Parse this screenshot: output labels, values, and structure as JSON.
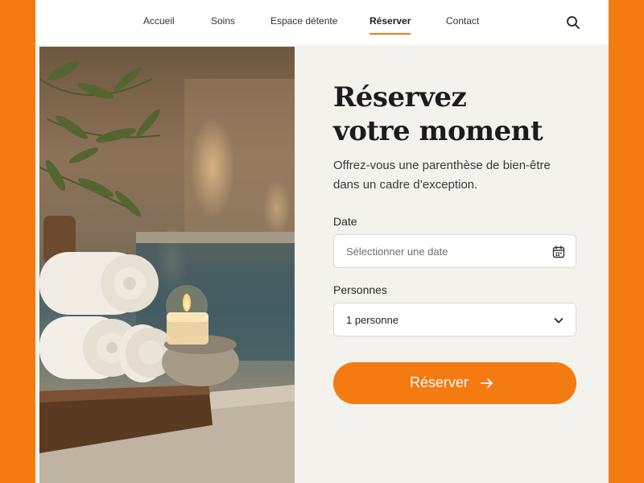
{
  "nav": {
    "items": [
      {
        "label": "Accueil"
      },
      {
        "label": "Soins"
      },
      {
        "label": "Espace détente"
      },
      {
        "label": "Réserver",
        "active": true
      },
      {
        "label": "Contact"
      }
    ],
    "search_icon": "search-icon"
  },
  "hero": {
    "image": "spa scene with rolled towels, lit candle, olive branch and pool"
  },
  "booking": {
    "title_line1": "Réservez",
    "title_line2": "votre moment",
    "subtitle_line1": "Offrez-vous une parenthèse de bien-être",
    "subtitle_line2": "dans un cadre d’exception.",
    "date": {
      "label": "Date",
      "placeholder": "Sélectionner une date",
      "icon": "calendar-icon"
    },
    "persons": {
      "label": "Personnes",
      "value": "1 personne",
      "icon": "chevron-down-icon"
    },
    "submit": {
      "label": "Réserver",
      "icon": "arrow-right-icon"
    }
  },
  "colors": {
    "accent": "#F47A12",
    "panel_bg": "#F4F2ED",
    "text": "#1C1C1C"
  }
}
